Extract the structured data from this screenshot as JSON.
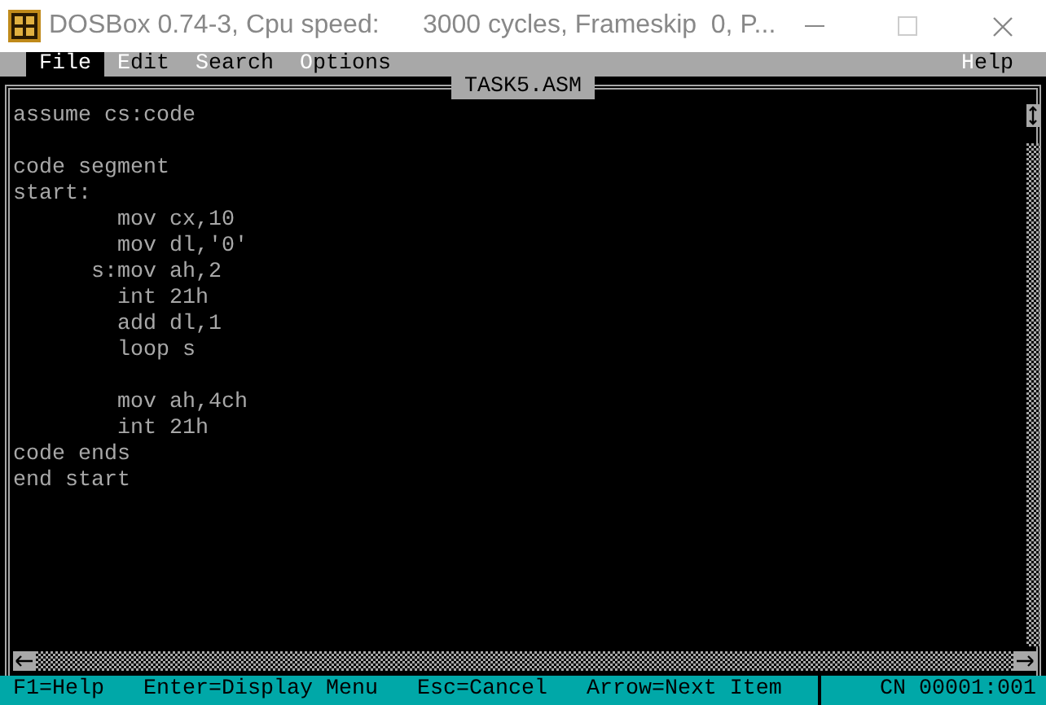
{
  "window": {
    "title": "DOSBox 0.74-3, Cpu speed:      3000 cycles, Frameskip  0, P..."
  },
  "menu": [
    {
      "label": "File",
      "selected": true
    },
    {
      "label": "Edit",
      "selected": false
    },
    {
      "label": "Search",
      "selected": false
    },
    {
      "label": "Options",
      "selected": false
    }
  ],
  "menu_right": {
    "label": "Help",
    "selected": false
  },
  "editor": {
    "title": "TASK5.ASM",
    "lines": [
      {
        "kind": "code",
        "text": "assume cs:code"
      },
      {
        "kind": "blank"
      },
      {
        "kind": "code",
        "text": "code segment"
      },
      {
        "kind": "code",
        "text": "start:"
      },
      {
        "kind": "code",
        "text": "        mov cx,10"
      },
      {
        "kind": "code",
        "text": "        mov dl,'0'"
      },
      {
        "kind": "code",
        "text": "      s:mov ah,2"
      },
      {
        "kind": "code",
        "text": "        int 21h"
      },
      {
        "kind": "code",
        "text": "        add dl,1"
      },
      {
        "kind": "code",
        "text": "        loop s"
      },
      {
        "kind": "blank"
      },
      {
        "kind": "code",
        "text": "        mov ah,4ch"
      },
      {
        "kind": "code",
        "text": "        int 21h"
      },
      {
        "kind": "code",
        "text": "code ends"
      },
      {
        "kind": "code",
        "text": "end start"
      }
    ]
  },
  "status_bar": {
    "hints": [
      "F1=Help",
      "Enter=Display Menu",
      "Esc=Cancel",
      "Arrow=Next Item"
    ],
    "position": "CN 00001:001"
  }
}
